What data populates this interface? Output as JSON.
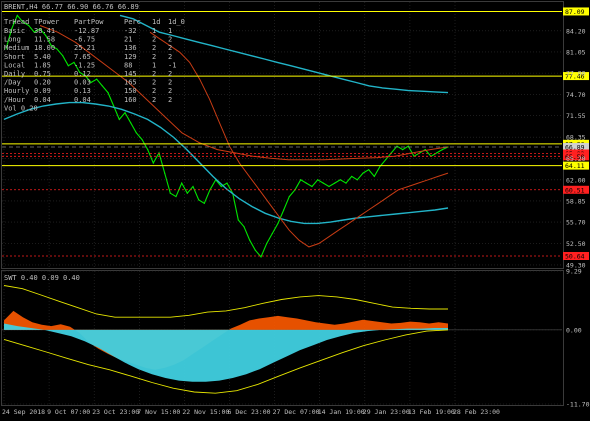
{
  "header": {
    "title": "BRENT,H4 66.77 66.90 66.76 66.89",
    "indicator_title": "SWT 0.40 0.09 0.40"
  },
  "stats_table": {
    "columns": [
      "TrHead",
      "TPower",
      "PartPow",
      "Perc",
      "1d",
      "1d_0"
    ],
    "rows": [
      {
        "label": "Basic",
        "v": [
          "38.41",
          "-12.87",
          "-32",
          "1",
          "1"
        ]
      },
      {
        "label": "Long",
        "v": [
          "11.58",
          "-6.75",
          "21",
          "2",
          "2"
        ]
      },
      {
        "label": "Medium",
        "v": [
          "18.00",
          "25.21",
          "136",
          "2",
          "2"
        ]
      },
      {
        "label": "Short",
        "v": [
          "5.40",
          "7.65",
          "129",
          "2",
          "2"
        ]
      },
      {
        "label": "Local",
        "v": [
          "1.85",
          "-1.25",
          "88",
          "1",
          "-1"
        ]
      },
      {
        "label": "Daily",
        "v": [
          "0.75",
          "0.12",
          "145",
          "2",
          "2"
        ]
      },
      {
        "label": "/Day",
        "v": [
          "0.20",
          "0.03",
          "165",
          "2",
          "2"
        ]
      },
      {
        "label": "Hourly",
        "v": [
          "0.09",
          "0.13",
          "150",
          "2",
          "2"
        ]
      },
      {
        "label": "/Hour",
        "v": [
          "0.04",
          "0.04",
          "160",
          "2",
          "2"
        ]
      }
    ],
    "footer": "Vol 0.20"
  },
  "colors": {
    "price": "#00e600",
    "ma_cyan": "#22b4c8",
    "ma_red": "#c83c14",
    "level_yellow": "#ffff00",
    "level_red": "#ff2020",
    "grid": "#2e2e2e",
    "ind_orange": "#ff5a00",
    "ind_cyan": "#40d0e0",
    "ind_blue": "#5aa0dc",
    "ind_yellow": "#e6e600"
  },
  "chart_data": [
    {
      "type": "line",
      "title": "BRENT,H4",
      "y_ticks": [
        84.2,
        81.05,
        77.9,
        74.7,
        71.55,
        68.35,
        65.2,
        62.0,
        58.85,
        55.7,
        52.5,
        49.3
      ],
      "ylim": [
        49.0,
        88.5
      ],
      "x_ticks": [
        "24 Sep 2018",
        "9 Oct 07:00",
        "23 Oct 23:00",
        "7 Nov 15:00",
        "22 Nov 15:00",
        "6 Dec 23:00",
        "27 Dec 07:00",
        "14 Jan 19:00",
        "29 Jan 23:00",
        "13 Feb 19:00",
        "28 Feb 23:00"
      ],
      "price_tags": [
        {
          "value": "87.09",
          "kind": "yellow"
        },
        {
          "value": "77.46",
          "kind": "yellow"
        },
        {
          "value": "67.36",
          "kind": "yellow"
        },
        {
          "value": "66.89",
          "kind": "current"
        },
        {
          "value": "65.92",
          "kind": "red"
        },
        {
          "value": "65.50",
          "kind": "red"
        },
        {
          "value": "64.11",
          "kind": "yellow"
        },
        {
          "value": "60.51",
          "kind": "red"
        },
        {
          "value": "50.64",
          "kind": "red"
        }
      ],
      "series": [
        {
          "name": "",
          "role": "price",
          "values": [
            81.5,
            84.5,
            86.5,
            85.5,
            85.0,
            84.0,
            84.5,
            83.5,
            82.0,
            81.5,
            80.5,
            79.0,
            79.5,
            78.0,
            77.5,
            76.5,
            77.0,
            76.0,
            75.0,
            73.0,
            71.0,
            72.0,
            70.5,
            69.0,
            68.0,
            66.5,
            64.5,
            66.0,
            63.0,
            60.0,
            59.5,
            61.5,
            60.0,
            61.0,
            59.0,
            58.5,
            60.5,
            62.0,
            61.0,
            61.5,
            60.0,
            56.0,
            55.0,
            53.0,
            51.5,
            50.5,
            52.5,
            54.0,
            55.5,
            57.5,
            59.5,
            60.5,
            62.0,
            61.5,
            61.0,
            62.0,
            61.5,
            61.0,
            61.5,
            62.0,
            61.5,
            62.5,
            62.0,
            63.0,
            63.5,
            62.5,
            64.0,
            65.0,
            66.0,
            67.0,
            66.5,
            67.0,
            65.5,
            66.0,
            66.5,
            65.5,
            66.0,
            66.5,
            66.89
          ]
        },
        {
          "name": "",
          "role": "ma_cyan",
          "values": [
            71.0,
            71.8,
            72.5,
            73.0,
            73.3,
            73.5,
            73.5,
            73.3,
            73.0,
            72.5,
            71.8,
            71.0,
            69.8,
            68.3,
            66.5,
            64.5,
            62.5,
            60.7,
            59.2,
            58.0,
            57.0,
            56.3,
            55.8,
            55.5,
            55.5,
            55.7,
            56.0,
            56.3,
            56.5,
            56.7,
            56.9,
            57.1,
            57.3,
            57.5,
            57.8
          ]
        },
        {
          "name": "",
          "role": "ma_cyan_slow",
          "values": [
            86.5,
            86.0,
            85.0,
            84.0,
            83.5,
            83.0,
            82.5,
            82.0,
            81.5,
            81.0,
            80.5,
            80.0,
            79.5,
            79.0,
            78.5,
            78.0,
            77.5,
            77.0,
            76.5,
            76.0,
            75.7,
            75.5,
            75.3,
            75.2,
            75.1,
            75.0
          ]
        },
        {
          "name": "",
          "role": "ma_red",
          "values": [
            84.0,
            83.0,
            82.0,
            81.0,
            79.5,
            77.0,
            74.0,
            70.5,
            67.0,
            64.5,
            62.5,
            60.5,
            58.5,
            56.5,
            54.5,
            53.0,
            52.0,
            52.5,
            53.5,
            54.5,
            55.5,
            56.5,
            57.5,
            58.5,
            59.5,
            60.5,
            61.0,
            61.5,
            62.0,
            62.5,
            63.0
          ]
        },
        {
          "name": "",
          "role": "ma_red_fast",
          "values": [
            85.0,
            84.0,
            82.5,
            80.5,
            78.5,
            76.5,
            74.0,
            71.5,
            69.0,
            67.5,
            66.5,
            66.0,
            65.5,
            65.2,
            65.0,
            65.0,
            65.0,
            65.1,
            65.2,
            65.3,
            65.5,
            66.0,
            66.5,
            66.9
          ]
        }
      ]
    },
    {
      "type": "area",
      "title": "SWT",
      "y_ticks": [
        9.29,
        0.0,
        -11.7
      ],
      "ylim": [
        -11.7,
        9.29
      ],
      "series": [
        {
          "name": "",
          "role": "orange_hist",
          "values": [
            1.5,
            3.0,
            2.0,
            1.2,
            0.8,
            0.6,
            0.9,
            0.5,
            -0.5,
            -2.0,
            -3.0,
            -3.8,
            -4.5,
            -5.0,
            -5.5,
            -6.0,
            -6.3,
            -6.0,
            -5.5,
            -4.8,
            -3.8,
            -2.8,
            -1.8,
            -0.8,
            0.2,
            0.8,
            1.5,
            1.8,
            2.0,
            2.2,
            2.0,
            1.8,
            1.5,
            1.2,
            1.0,
            0.8,
            1.0,
            1.3,
            1.6,
            1.4,
            1.2,
            1.0,
            1.1,
            1.3,
            1.2,
            1.0,
            1.2,
            1.0
          ]
        },
        {
          "name": "",
          "role": "cyan_area",
          "values": [
            1.0,
            0.6,
            0.3,
            0.0,
            -0.5,
            -1.0,
            -1.8,
            -2.8,
            -4.0,
            -5.2,
            -6.2,
            -7.0,
            -7.6,
            -8.0,
            -8.2,
            -8.2,
            -8.0,
            -7.6,
            -7.0,
            -6.2,
            -5.2,
            -4.2,
            -3.2,
            -2.4,
            -1.6,
            -1.0,
            -0.5,
            -0.2,
            0.0,
            0.1,
            0.2,
            0.2,
            0.3,
            0.3
          ]
        },
        {
          "name": "",
          "role": "upper_band",
          "values": [
            7.0,
            6.5,
            5.5,
            4.5,
            3.5,
            2.5,
            2.0,
            2.0,
            2.0,
            2.0,
            2.3,
            2.8,
            3.0,
            3.5,
            4.2,
            4.8,
            5.2,
            5.4,
            5.2,
            4.8,
            4.2,
            3.6,
            3.4,
            3.3,
            3.3
          ]
        },
        {
          "name": "",
          "role": "lower_band",
          "values": [
            -1.5,
            -2.5,
            -3.5,
            -4.5,
            -5.5,
            -6.3,
            -7.3,
            -8.3,
            -9.2,
            -9.8,
            -10.0,
            -9.6,
            -8.6,
            -7.3,
            -6.0,
            -4.8,
            -3.6,
            -2.5,
            -1.6,
            -0.8,
            -0.2,
            0.0
          ]
        }
      ]
    }
  ]
}
